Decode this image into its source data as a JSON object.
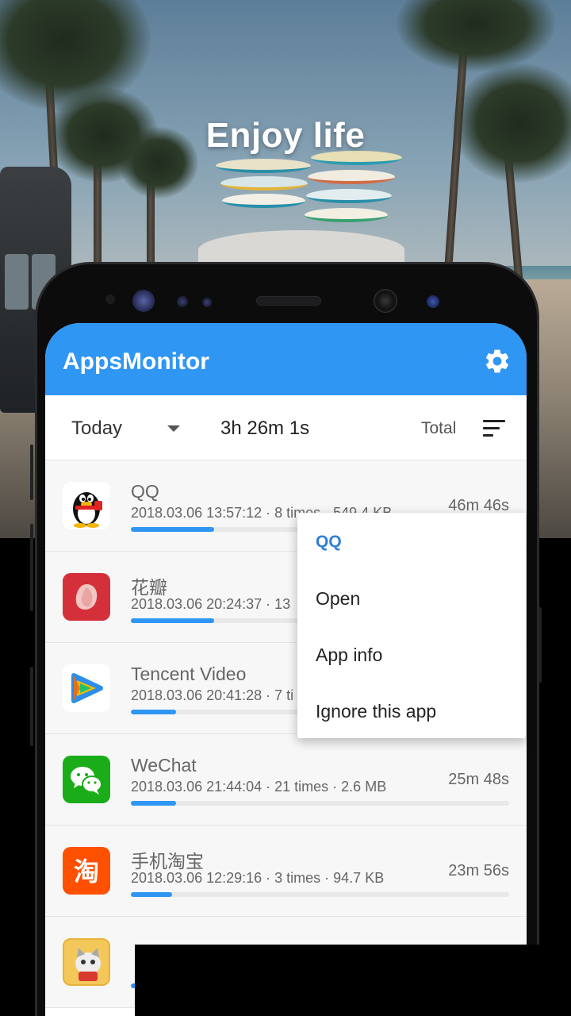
{
  "headline": "Enjoy life",
  "app": {
    "title": "AppsMonitor",
    "settings_icon": "gear-icon",
    "bar_color": "#2f96f3"
  },
  "filter": {
    "period": "Today",
    "total_time": "3h 26m 1s",
    "sort_label": "Total"
  },
  "apps": [
    {
      "name": "QQ",
      "meta": "2018.03.06 13:57:12 · 8 times · 549.4 KB",
      "duration": "46m 46s",
      "usage_fraction": 0.22
    },
    {
      "name": "花瓣",
      "meta": "2018.03.06 20:24:37 · 13",
      "duration": "",
      "usage_fraction": 0.22
    },
    {
      "name": "Tencent Video",
      "meta": "2018.03.06 20:41:28 · 7 ti",
      "duration": "",
      "usage_fraction": 0.12
    },
    {
      "name": "WeChat",
      "meta": "2018.03.06 21:44:04 · 21 times · 2.6 MB",
      "duration": "25m 48s",
      "usage_fraction": 0.12
    },
    {
      "name": "手机淘宝",
      "meta": "2018.03.06 12:29:16 · 3 times · 94.7 KB",
      "duration": "23m 56s",
      "usage_fraction": 0.11
    },
    {
      "name": "",
      "meta": "",
      "duration": "",
      "usage_fraction": 0.05
    }
  ],
  "context_menu": {
    "title": "QQ",
    "items": [
      "Open",
      "App info",
      "Ignore this app"
    ]
  }
}
